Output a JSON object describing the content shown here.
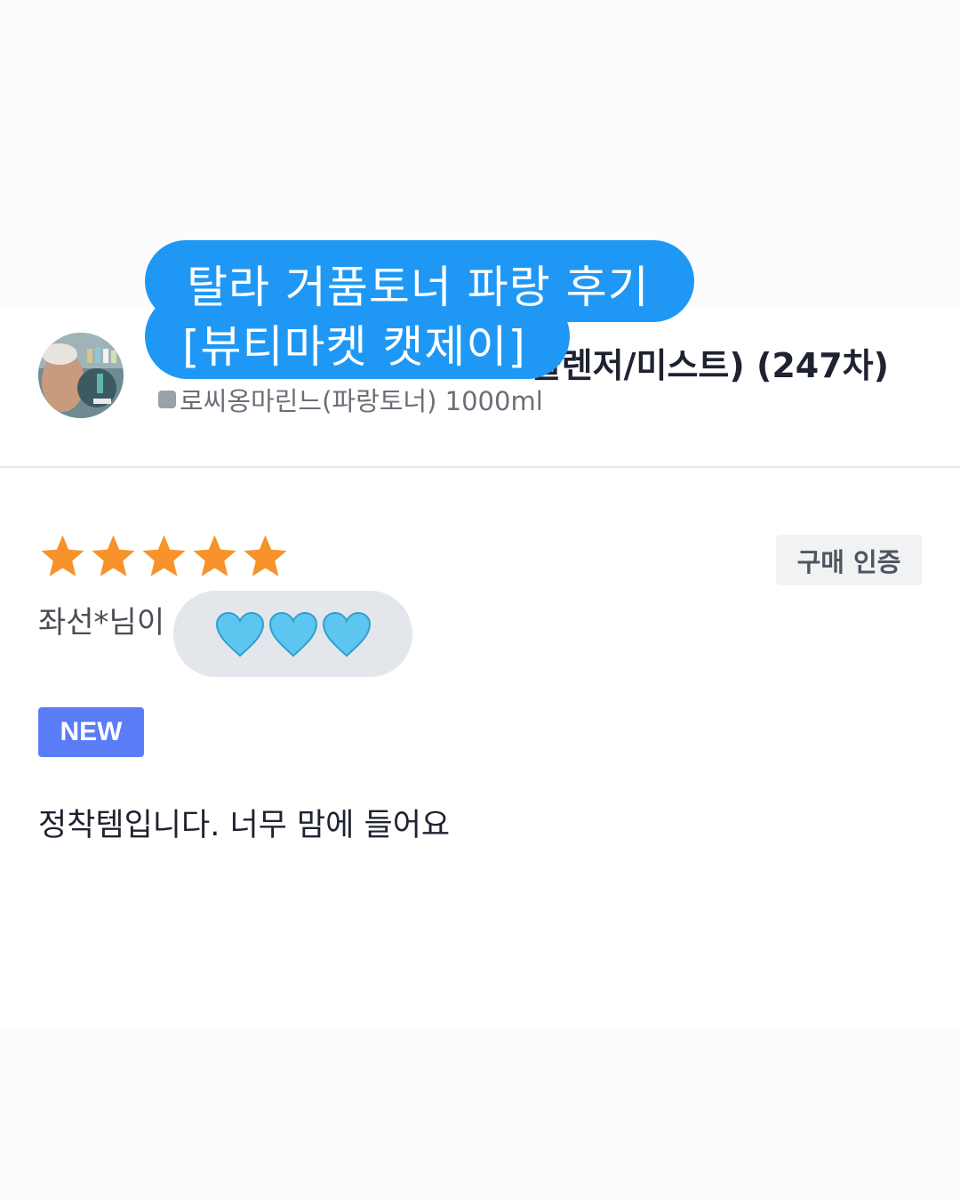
{
  "overlay": {
    "line1": "탈라 거품토너 파랑 후기",
    "line2": "[뷰티마켓 캣제이]",
    "hearts": [
      "💙",
      "💙",
      "💙"
    ],
    "hearts_color": "#5cc6f1"
  },
  "product": {
    "title_visible": "클렌저/미스트) (247차)",
    "option": "로씨옹마린느(파랑토너) 1000ml"
  },
  "review": {
    "rating": 5,
    "max_rating": 5,
    "star_color": "#f7932a",
    "reviewer_visible": "좌선*님이",
    "verified_label": "구매 인증",
    "new_label": "NEW",
    "text": "정착템입니다. 너무 맘에 들어요"
  },
  "colors": {
    "bubble_blue": "#1f98f5",
    "new_badge": "#5b7cf7"
  }
}
